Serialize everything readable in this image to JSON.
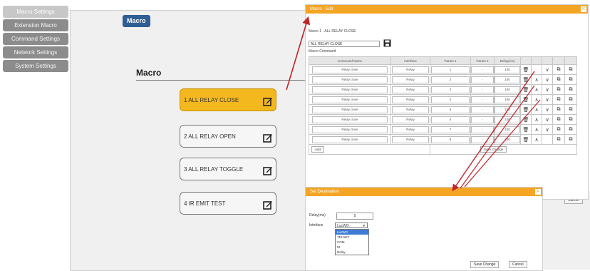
{
  "sidebar": {
    "items": [
      {
        "label": "Macro Settings",
        "active": true
      },
      {
        "label": "Extension Macro",
        "active": false
      },
      {
        "label": "Command Settings",
        "active": false
      },
      {
        "label": "Network Settings",
        "active": false
      },
      {
        "label": "System Settings",
        "active": false
      }
    ]
  },
  "panel": {
    "tab_label": "Macro",
    "title": "Macro",
    "macros": [
      {
        "label": "1 ALL RELAY CLOSE",
        "selected": true
      },
      {
        "label": "2 ALL RELAY OPEN",
        "selected": false
      },
      {
        "label": "3 ALL RELAY TOGGLE",
        "selected": false
      },
      {
        "label": "4 IR EMIT TEST",
        "selected": false
      }
    ]
  },
  "edit_dialog": {
    "title": "Macro - Edit",
    "macro_heading": "Macro 1 - ALL RELAY CLOSE",
    "name_value": "ALL RELAY CLOSE",
    "command_heading": "Macro Command",
    "columns": [
      "Command Name",
      "Interface",
      "Param 1",
      "Param 2",
      "Delay(ms)"
    ],
    "rows": [
      {
        "name": "Relay close",
        "interface": "Relay",
        "p1": "1",
        "p2": "-",
        "delay": "100"
      },
      {
        "name": "Relay close",
        "interface": "Relay",
        "p1": "2",
        "p2": "-",
        "delay": "100"
      },
      {
        "name": "Relay close",
        "interface": "Relay",
        "p1": "3",
        "p2": "-",
        "delay": "100"
      },
      {
        "name": "Relay close",
        "interface": "Relay",
        "p1": "4",
        "p2": "-",
        "delay": "100"
      },
      {
        "name": "Relay close",
        "interface": "Relay",
        "p1": "5",
        "p2": "-",
        "delay": "100"
      },
      {
        "name": "Relay close",
        "interface": "Relay",
        "p1": "6",
        "p2": "-",
        "delay": "100"
      },
      {
        "name": "Relay close",
        "interface": "Relay",
        "p1": "7",
        "p2": "-",
        "delay": "100"
      },
      {
        "name": "Relay close",
        "interface": "Relay",
        "p1": "8",
        "p2": "-",
        "delay": "100"
      }
    ],
    "add_label": "Add",
    "save_change_label": "Save Change",
    "cancel_label": "Cancel"
  },
  "set_dialog": {
    "title": "Set Destination",
    "delay_label": "Delay(ms)",
    "delay_value": "0",
    "interface_label": "Interface",
    "interface_selected": "LucWO",
    "options": [
      "LucWO",
      "TELNET",
      "COM",
      "IR",
      "Relay"
    ],
    "save_label": "Save Change",
    "cancel_label": "Cancel"
  },
  "colors": {
    "accent": "#f4a524",
    "selected_macro": "#f4b81f",
    "tab_blue": "#2e5e92",
    "sidebar_gray": "#8c8c8c",
    "arrow_red": "#c0242a"
  }
}
